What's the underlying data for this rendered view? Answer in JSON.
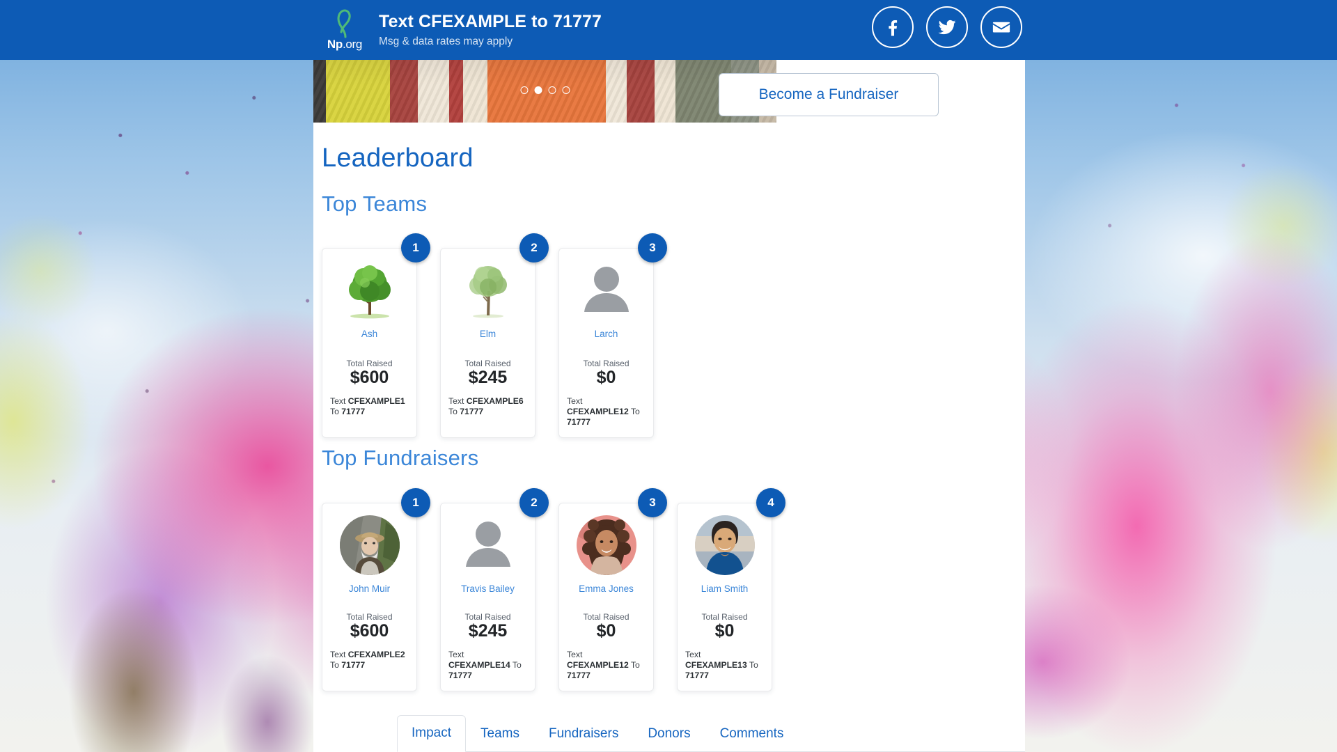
{
  "topbar": {
    "logo_word_bold": "Np",
    "logo_word_rest": ".org",
    "logo_icon": "green-ribbon-icon",
    "headline": "Text CFEXAMPLE to 71777",
    "subline": "Msg & data rates may apply",
    "socials": [
      {
        "name": "facebook-icon",
        "label": "Facebook"
      },
      {
        "name": "twitter-icon",
        "label": "Twitter"
      },
      {
        "name": "email-icon",
        "label": "Email"
      }
    ]
  },
  "hero": {
    "carousel_dots": 4,
    "active_dot": 2
  },
  "actions": {
    "primary_label": "",
    "secondary_label": "Become a Fundraiser"
  },
  "leaderboard": {
    "title": "Leaderboard",
    "teams_title": "Top Teams",
    "fundraisers_title": "Top Fundraisers",
    "total_raised_label": "Total Raised",
    "text_word": "Text",
    "to_word": "To",
    "shortcode": "71777",
    "teams": [
      {
        "rank": "1",
        "name": "Ash",
        "avatar": "tree-green-full-icon",
        "total_raised_label": "Total Raised",
        "amount": "$600",
        "keyword": "CFEXAMPLE1",
        "shortcode": "71777"
      },
      {
        "rank": "2",
        "name": "Elm",
        "avatar": "tree-light-icon",
        "total_raised_label": "Total Raised",
        "amount": "$245",
        "keyword": "CFEXAMPLE6",
        "shortcode": "71777"
      },
      {
        "rank": "3",
        "name": "Larch",
        "avatar": "placeholder-person-icon",
        "total_raised_label": "Total Raised",
        "amount": "$0",
        "keyword": "CFEXAMPLE12",
        "shortcode": "71777"
      }
    ],
    "fundraisers": [
      {
        "rank": "1",
        "name": "John Muir",
        "avatar": "photo-bearded-man-hat-icon",
        "total_raised_label": "Total Raised",
        "amount": "$600",
        "keyword": "CFEXAMPLE2",
        "shortcode": "71777"
      },
      {
        "rank": "2",
        "name": "Travis Bailey",
        "avatar": "placeholder-person-icon",
        "total_raised_label": "Total Raised",
        "amount": "$245",
        "keyword": "CFEXAMPLE14",
        "shortcode": "71777"
      },
      {
        "rank": "3",
        "name": "Emma Jones",
        "avatar": "photo-curly-hair-woman-icon",
        "total_raised_label": "Total Raised",
        "amount": "$0",
        "keyword": "CFEXAMPLE12",
        "shortcode": "71777"
      },
      {
        "rank": "4",
        "name": "Liam Smith",
        "avatar": "photo-smiling-man-icon",
        "total_raised_label": "Total Raised",
        "amount": "$0",
        "keyword": "CFEXAMPLE13",
        "shortcode": "71777"
      }
    ]
  },
  "tabs": [
    {
      "label": "Impact",
      "active": true
    },
    {
      "label": "Teams",
      "active": false
    },
    {
      "label": "Fundraisers",
      "active": false
    },
    {
      "label": "Donors",
      "active": false
    },
    {
      "label": "Comments",
      "active": false
    }
  ],
  "colors": {
    "brand_blue": "#0d5bb5",
    "link_blue": "#1565c0",
    "heading_blue": "#3b86d8",
    "ribbon_green": "#4fba78"
  }
}
